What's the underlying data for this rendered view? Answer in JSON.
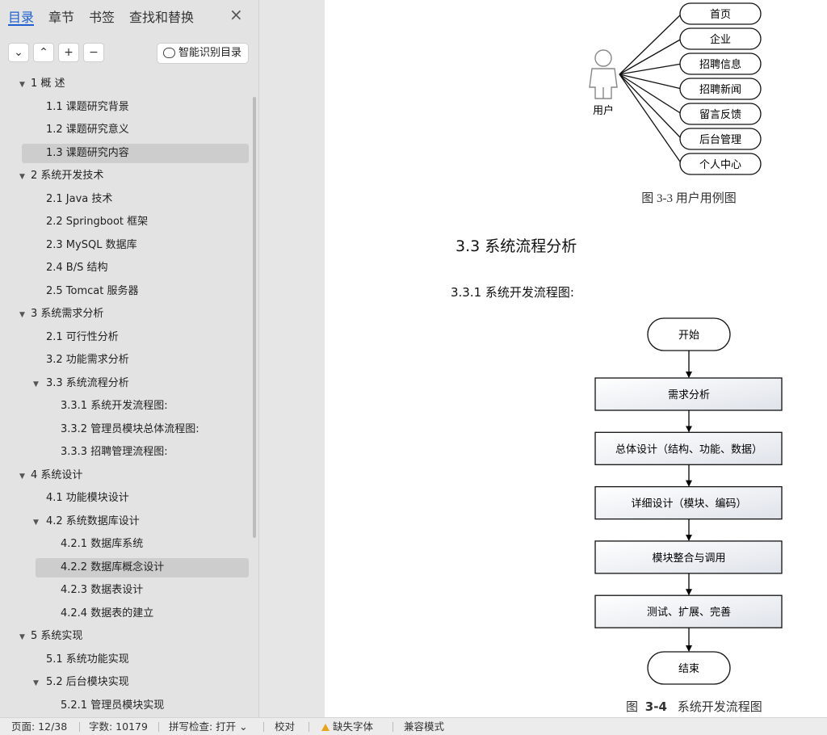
{
  "sidebar": {
    "tabs": [
      "目录",
      "章节",
      "书签",
      "查找和替换"
    ],
    "close": "×",
    "toolbar": {
      "collapse": "⌄",
      "expand": "⌃",
      "add": "+",
      "remove": "−",
      "smart": "智能识别目录"
    },
    "toc": [
      {
        "text": "1  概    述",
        "level": 0,
        "arrow": "down"
      },
      {
        "text": "1.1  课题研究背景",
        "level": 1
      },
      {
        "text": "1.2  课题研究意义",
        "level": 1
      },
      {
        "text": "1.3  课题研究内容",
        "level": 1,
        "selected": true
      },
      {
        "text": "2   系统开发技术",
        "level": 0,
        "arrow": "down"
      },
      {
        "text": "2.1 Java 技术",
        "level": 1
      },
      {
        "text": "2.2 Springboot 框架",
        "level": 1
      },
      {
        "text": "2.3 MySQL 数据库",
        "level": 1
      },
      {
        "text": "2.4 B/S 结构",
        "level": 1
      },
      {
        "text": "2.5 Tomcat 服务器",
        "level": 1
      },
      {
        "text": "3   系统需求分析",
        "level": 0,
        "arrow": "down"
      },
      {
        "text": "2.1  可行性分析",
        "level": 1
      },
      {
        "text": "3.2  功能需求分析",
        "level": 1
      },
      {
        "text": "3.3  系统流程分析",
        "level": 1,
        "arrow": "down"
      },
      {
        "text": "3.3.1 系统开发流程图:",
        "level": 2
      },
      {
        "text": "3.3.2 管理员模块总体流程图:",
        "level": 2
      },
      {
        "text": "3.3.3 招聘管理流程图:",
        "level": 2
      },
      {
        "text": "4   系统设计",
        "level": 0,
        "arrow": "down"
      },
      {
        "text": "4.1  功能模块设计",
        "level": 1
      },
      {
        "text": "4.2  系统数据库设计",
        "level": 1,
        "arrow": "down"
      },
      {
        "text": "4.2.1  数据库系统",
        "level": 2
      },
      {
        "text": "4.2.2  数据库概念设计",
        "level": 2,
        "selected": true
      },
      {
        "text": "4.2.3  数据表设计",
        "level": 2
      },
      {
        "text": "4.2.4  数据表的建立",
        "level": 2
      },
      {
        "text": "5   系统实现",
        "level": 0,
        "arrow": "down"
      },
      {
        "text": "5.1 系统功能实现",
        "level": 1
      },
      {
        "text": "5.2 后台模块实现",
        "level": 1,
        "arrow": "down"
      },
      {
        "text": "5.2.1 管理员模块实现",
        "level": 2
      }
    ]
  },
  "document": {
    "usecase": {
      "actor": "用户",
      "cases": [
        "首页",
        "企业",
        "招聘信息",
        "招聘新闻",
        "留言反馈",
        "后台管理",
        "个人中心"
      ],
      "caption": "图 3-3  用户用例图"
    },
    "section_title": "3.3  系统流程分析",
    "subsection_title": "3.3.1 系统开发流程图:",
    "flow": {
      "start": "开始",
      "steps": [
        "需求分析",
        "总体设计（结构、功能、数据）",
        "详细设计（模块、编码）",
        "模块整合与调用",
        "测试、扩展、完善"
      ],
      "end": "结束",
      "caption_prefix": "图",
      "caption_num": "3-4",
      "caption_text": "系统开发流程图"
    }
  },
  "statusbar": {
    "page": "页面: 12/38",
    "words": "字数: 10179",
    "spell": "拼写检查: 打开 ⌄",
    "proof": "校对",
    "missing_font": "缺失字体",
    "compat": "兼容模式"
  }
}
